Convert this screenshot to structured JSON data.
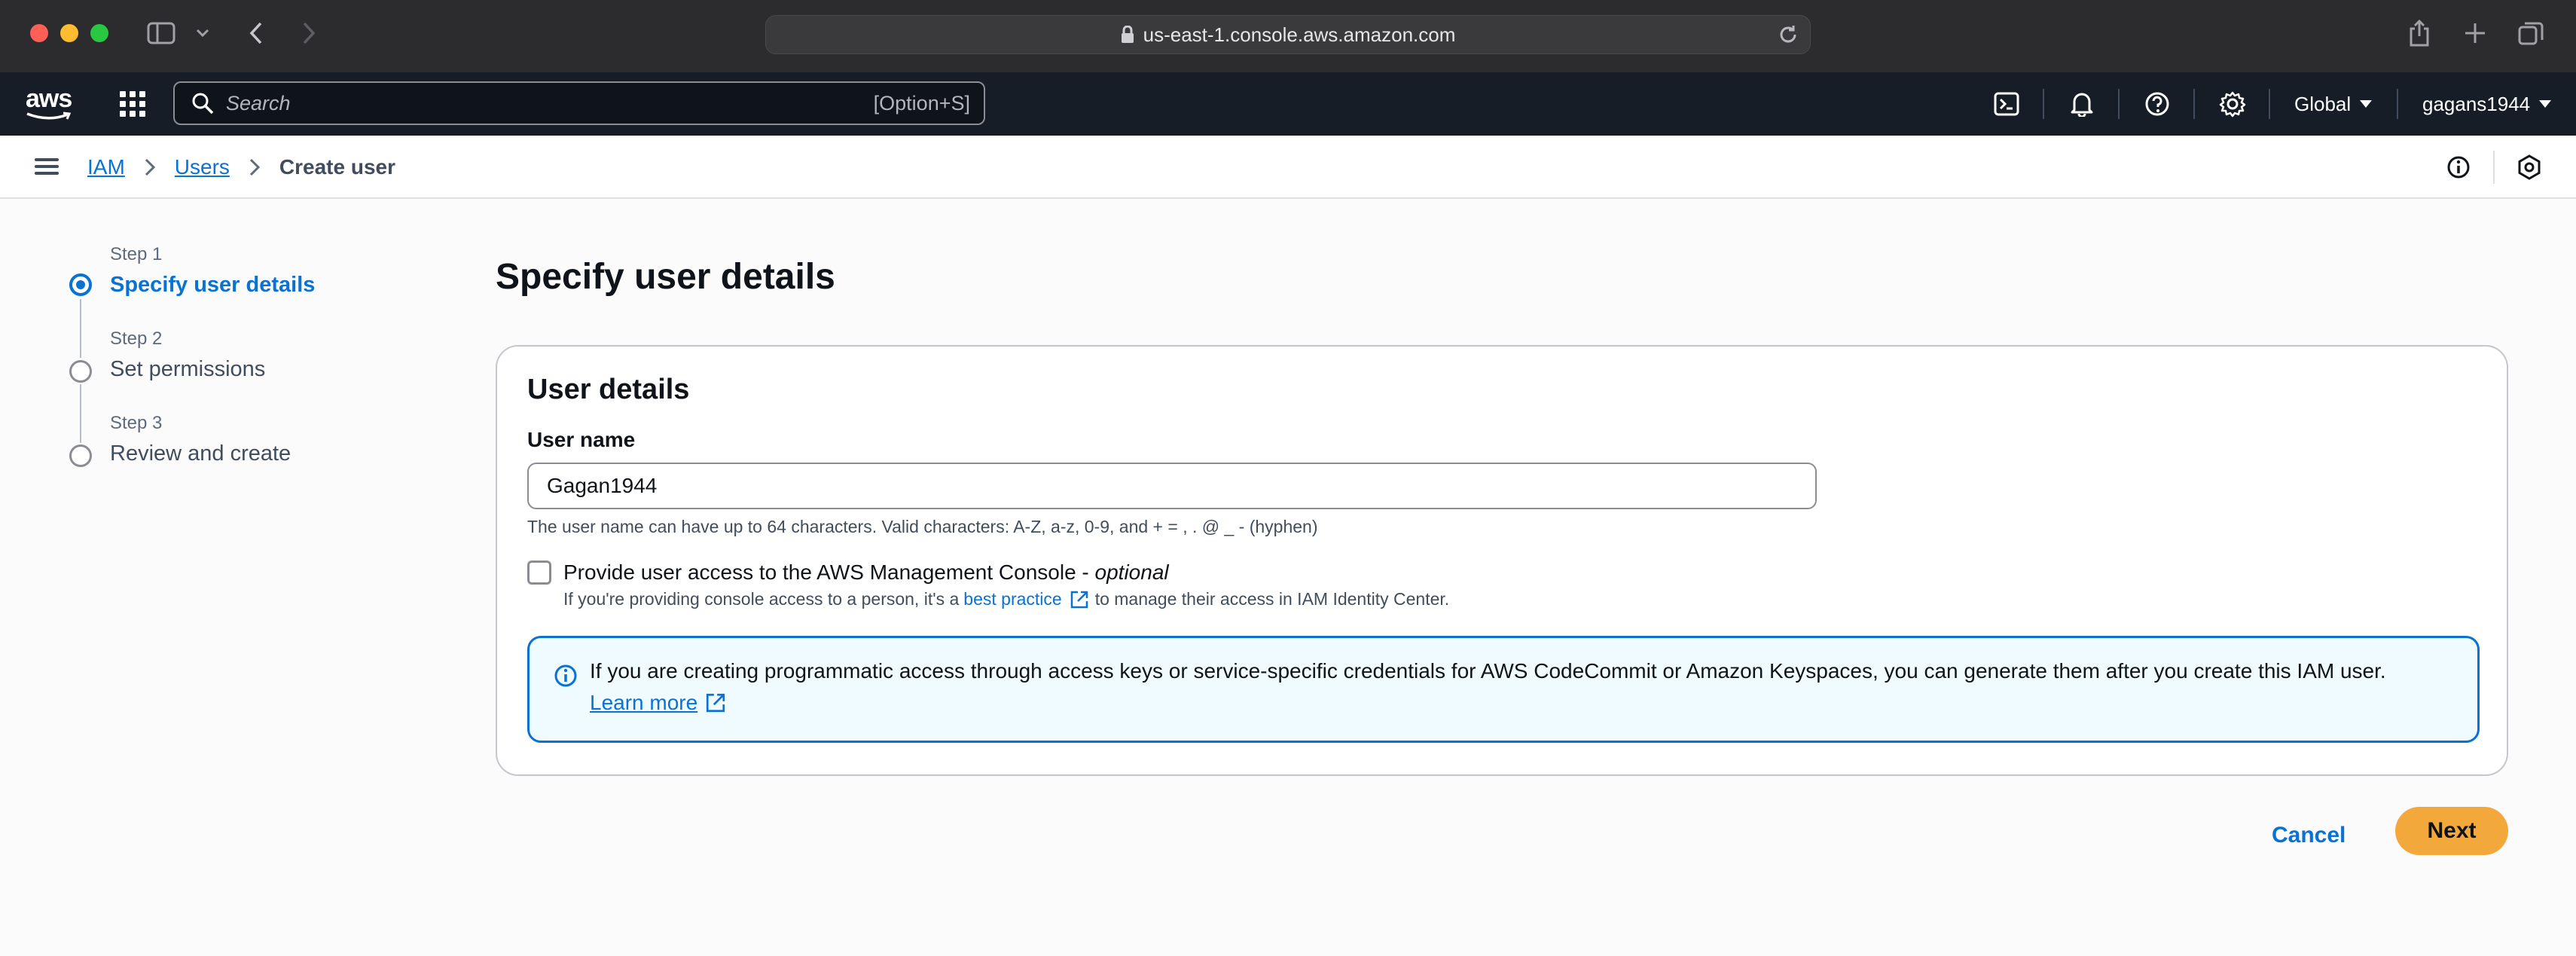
{
  "browser": {
    "url": "us-east-1.console.aws.amazon.com"
  },
  "topnav": {
    "logo": "aws",
    "search_placeholder": "Search",
    "search_shortcut": "[Option+S]",
    "region": "Global",
    "account": "gagans1944"
  },
  "breadcrumb": {
    "items": [
      "IAM",
      "Users"
    ],
    "current": "Create user"
  },
  "steps": [
    {
      "step": "Step 1",
      "title": "Specify user details",
      "active": true
    },
    {
      "step": "Step 2",
      "title": "Set permissions",
      "active": false
    },
    {
      "step": "Step 3",
      "title": "Review and create",
      "active": false
    }
  ],
  "main": {
    "title": "Specify user details",
    "panel": {
      "title": "User details",
      "username_label": "User name",
      "username_value": "Gagan1944",
      "username_hint": "The user name can have up to 64 characters. Valid characters: A-Z, a-z, 0-9, and + = , . @ _ - (hyphen)",
      "console_access_label": "Provide user access to the AWS Management Console - ",
      "console_access_optional": "optional",
      "console_access_checked": false,
      "console_desc_prefix": "If you're providing console access to a person, it's a",
      "console_desc_link": "best practice",
      "console_desc_suffix": "to manage their access in IAM Identity Center.",
      "info_text": "If you are creating programmatic access through access keys or service-specific credentials for AWS CodeCommit or Amazon Keyspaces, you can generate them after you create this IAM user.",
      "info_link": "Learn more"
    },
    "cancel_label": "Cancel",
    "next_label": "Next"
  },
  "colors": {
    "accent": "#0972d3",
    "primary_button": "#f3a83c",
    "nav_bg": "#161d26"
  }
}
